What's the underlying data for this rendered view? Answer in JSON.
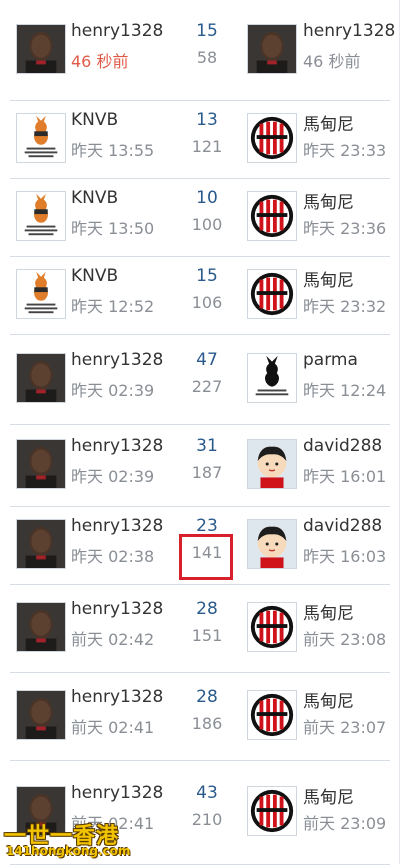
{
  "rows": [
    {
      "left_user": "henry1328",
      "left_time": "46 秒前",
      "left_avatar": "henry-photo",
      "replies": "15",
      "views": "58",
      "right_user": "henry1328",
      "right_time": "46 秒前",
      "right_avatar": "henry-photo"
    },
    {
      "left_user": "KNVB",
      "left_time": "昨天 13:55",
      "left_avatar": "playboy-logo",
      "replies": "13",
      "views": "121",
      "right_user": "馬甸尼",
      "right_time": "昨天 23:33",
      "right_avatar": "acmilan-logo"
    },
    {
      "left_user": "KNVB",
      "left_time": "昨天 13:50",
      "left_avatar": "playboy-logo",
      "replies": "10",
      "views": "100",
      "right_user": "馬甸尼",
      "right_time": "昨天 23:36",
      "right_avatar": "acmilan-logo"
    },
    {
      "left_user": "KNVB",
      "left_time": "昨天 12:52",
      "left_avatar": "playboy-logo",
      "replies": "15",
      "views": "106",
      "right_user": "馬甸尼",
      "right_time": "昨天 23:32",
      "right_avatar": "acmilan-logo"
    },
    {
      "left_user": "henry1328",
      "left_time": "昨天 02:39",
      "left_avatar": "henry-photo",
      "replies": "47",
      "views": "227",
      "right_user": "parma",
      "right_time": "昨天 12:24",
      "right_avatar": "playboy-black-logo"
    },
    {
      "left_user": "henry1328",
      "left_time": "昨天 02:39",
      "left_avatar": "henry-photo",
      "replies": "31",
      "views": "187",
      "right_user": "david288",
      "right_time": "昨天 16:01",
      "right_avatar": "cartoon-boy"
    },
    {
      "left_user": "henry1328",
      "left_time": "昨天 02:38",
      "left_avatar": "henry-photo",
      "replies": "23",
      "views": "141",
      "right_user": "david288",
      "right_time": "昨天 16:03",
      "right_avatar": "cartoon-boy"
    },
    {
      "left_user": "henry1328",
      "left_time": "前天 02:42",
      "left_avatar": "henry-photo",
      "replies": "28",
      "views": "151",
      "right_user": "馬甸尼",
      "right_time": "前天 23:08",
      "right_avatar": "acmilan-logo"
    },
    {
      "left_user": "henry1328",
      "left_time": "前天 02:41",
      "left_avatar": "henry-photo",
      "replies": "28",
      "views": "186",
      "right_user": "馬甸尼",
      "right_time": "前天 23:07",
      "right_avatar": "acmilan-logo"
    },
    {
      "left_user": "henry1328",
      "left_time": "前天 02:41",
      "left_avatar": "henry-photo",
      "replies": "43",
      "views": "210",
      "right_user": "馬甸尼",
      "right_time": "前天 23:09",
      "right_avatar": "acmilan-logo"
    }
  ],
  "watermark": {
    "cn": "一世一香港",
    "en": "141hongkong.com"
  },
  "colors": {
    "new_time": "#e05a48",
    "replies": "#2a5a8c",
    "highlight": "#d8202a"
  }
}
